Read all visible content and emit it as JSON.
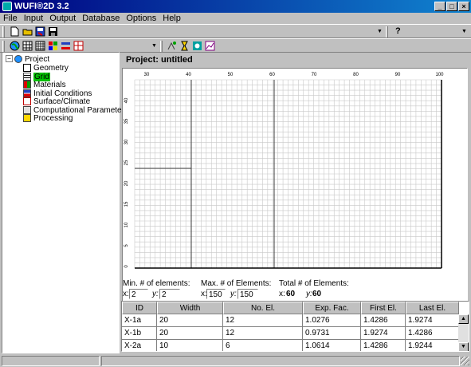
{
  "window": {
    "title": "WUFI®2D 3.2",
    "min": "_",
    "max": "□",
    "close": "×"
  },
  "menu": [
    "File",
    "Input",
    "Output",
    "Database",
    "Options",
    "Help"
  ],
  "toolbar": {
    "help_label": "?",
    "icons1": [
      "new-file-icon",
      "open-folder-icon",
      "save-as-icon",
      "save-icon"
    ],
    "icons2": [
      "globe-icon",
      "geometry-grid-icon",
      "grid-icon",
      "materials-icon",
      "initial-conditions-icon",
      "climate-icon",
      "calc-icon",
      "timer-icon",
      "eye-icon",
      "chart-icon"
    ]
  },
  "tree": {
    "root": "Project",
    "items": [
      {
        "label": "Geometry",
        "icon": "geometry-icon"
      },
      {
        "label": "Grid",
        "icon": "grid-icon",
        "selected": true
      },
      {
        "label": "Materials",
        "icon": "materials-icon"
      },
      {
        "label": "Initial Conditions",
        "icon": "initial-conditions-icon"
      },
      {
        "label": "Surface/Climate",
        "icon": "climate-icon"
      },
      {
        "label": "Computational Parameters",
        "icon": "compute-icon"
      },
      {
        "label": "Processing",
        "icon": "hourglass-icon"
      }
    ]
  },
  "main": {
    "project_title": "Project: untitled",
    "ruler_top": [
      "30",
      "40",
      "50",
      "60",
      "70",
      "80",
      "90",
      "100"
    ],
    "ruler_left": [
      "40",
      "35",
      "30",
      "25",
      "20",
      "15",
      "10",
      "5",
      "0"
    ]
  },
  "elements": {
    "min_label": "Min. # of elements:",
    "max_label": "Max. # of Elements:",
    "total_label": "Total # of Elements:",
    "x_label": "x:",
    "y_label": "y:",
    "min_x": "2",
    "min_y": "2",
    "max_x": "150",
    "max_y": "150",
    "total_x": "60",
    "total_y": "60"
  },
  "grid_table": {
    "headers": [
      "ID",
      "Width",
      "No. El.",
      "Exp. Fac.",
      "First El.",
      "Last El."
    ],
    "rows": [
      [
        "X-1a",
        "20",
        "12",
        "1.0276",
        "1.4286",
        "1.9274"
      ],
      [
        "X-1b",
        "20",
        "12",
        "0.9731",
        "1.9274",
        "1.4286"
      ],
      [
        "X-2a",
        "10",
        "6",
        "1.0614",
        "1.4286",
        "1.9244"
      ]
    ]
  },
  "colors": {
    "title_start": "#000080",
    "title_end": "#1084d0",
    "selected": "#00c000",
    "grid_line": "#c8c8c8"
  }
}
